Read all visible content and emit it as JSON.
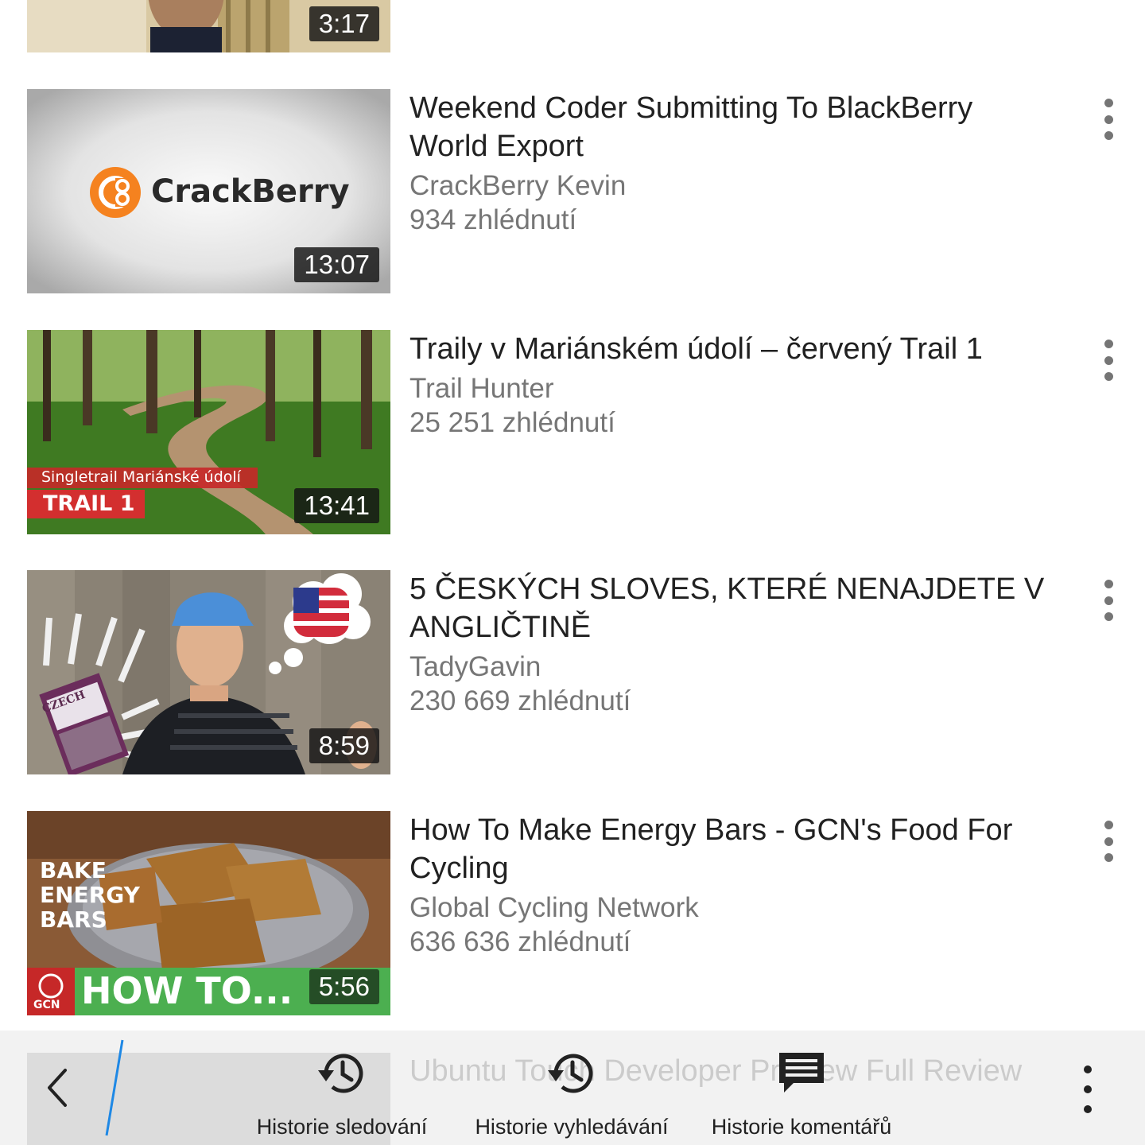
{
  "videos": [
    {
      "title": "",
      "channel": "",
      "views": "",
      "duration": "3:17"
    },
    {
      "title": "Weekend Coder Submitting To BlackBerry World Export",
      "channel": "CrackBerry Kevin",
      "views": "934 zhlédnutí",
      "duration": "13:07",
      "thumb_text": "CrackBerry"
    },
    {
      "title": "Traily v Mariánském údolí – červený Trail 1",
      "channel": "Trail Hunter",
      "views": "25 251 zhlédnutí",
      "duration": "13:41",
      "thumb_banner_top": "Singletrail Mariánské údolí",
      "thumb_banner_bottom": "TRAIL 1"
    },
    {
      "title": "5 ČESKÝCH SLOVES, KTERÉ NENAJDETE V ANGLIČTINĚ",
      "channel": "TadyGavin",
      "views": "230 669 zhlédnutí",
      "duration": "8:59",
      "thumb_book": "CZECH"
    },
    {
      "title": "How To Make Energy Bars - GCN's Food For Cycling",
      "channel": "Global Cycling Network",
      "views": "636 636 zhlédnutí",
      "duration": "5:56",
      "thumb_text_1": "BAKE",
      "thumb_text_2": "ENERGY",
      "thumb_text_3": "BARS",
      "thumb_banner": "HOW TO...",
      "thumb_logo": "GCN"
    },
    {
      "title": "Ubuntu Touch Developer Preview Full Review"
    }
  ],
  "bottom_bar": {
    "actions": [
      {
        "label": "Historie sledování",
        "icon": "history-icon"
      },
      {
        "label": "Historie vyhledávání",
        "icon": "history-icon"
      },
      {
        "label": "Historie komentářů",
        "icon": "comment-icon"
      }
    ]
  },
  "colors": {
    "accent": "#1e88e5",
    "title": "#212121",
    "meta": "#767676",
    "bar": "#f1f1f1"
  }
}
